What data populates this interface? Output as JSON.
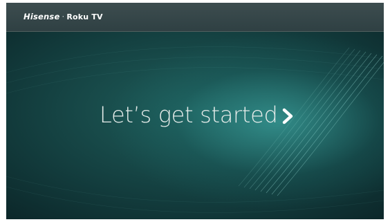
{
  "topbar": {
    "brand_primary": "Hisense",
    "brand_separator": "·",
    "brand_secondary": "Roku TV"
  },
  "main": {
    "headline": "Let’s get started",
    "next_icon": "chevron-right-icon"
  },
  "colors": {
    "topbar": "#34464a",
    "background_dark": "#0b2225",
    "background_glow": "#46bdb8",
    "text": "#e6ecea"
  }
}
